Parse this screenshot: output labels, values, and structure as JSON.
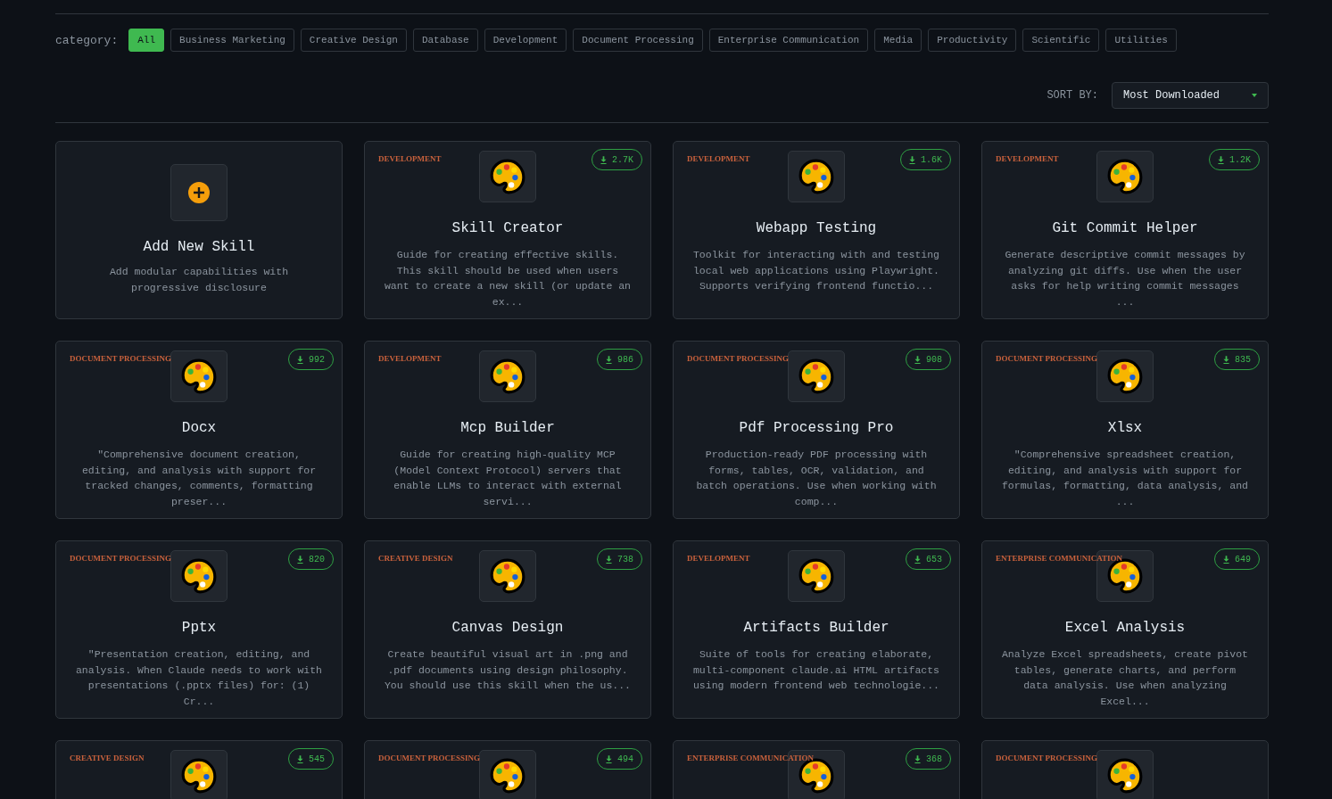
{
  "filter": {
    "label": "category:",
    "categories": [
      {
        "label": "All",
        "selected": true
      },
      {
        "label": "Business Marketing",
        "selected": false
      },
      {
        "label": "Creative Design",
        "selected": false
      },
      {
        "label": "Database",
        "selected": false
      },
      {
        "label": "Development",
        "selected": false
      },
      {
        "label": "Document Processing",
        "selected": false
      },
      {
        "label": "Enterprise Communication",
        "selected": false
      },
      {
        "label": "Media",
        "selected": false
      },
      {
        "label": "Productivity",
        "selected": false
      },
      {
        "label": "Scientific",
        "selected": false
      },
      {
        "label": "Utilities",
        "selected": false
      }
    ]
  },
  "sort": {
    "label": "SORT BY:",
    "value": "Most Downloaded"
  },
  "cards": [
    {
      "kind": "add",
      "title": "Add New Skill",
      "description": "Add modular capabilities with progressive disclosure"
    },
    {
      "kind": "skill",
      "category": "DEVELOPMENT",
      "downloads": "2.7K",
      "title": "Skill Creator",
      "description": "Guide for creating effective skills. This skill should be used when users want to create a new skill (or update an ex..."
    },
    {
      "kind": "skill",
      "category": "DEVELOPMENT",
      "downloads": "1.6K",
      "title": "Webapp Testing",
      "description": "Toolkit for interacting with and testing local web applications using Playwright. Supports verifying frontend functio..."
    },
    {
      "kind": "skill",
      "category": "DEVELOPMENT",
      "downloads": "1.2K",
      "title": "Git Commit Helper",
      "description": "Generate descriptive commit messages by analyzing git diffs. Use when the user asks for help writing commit messages ..."
    },
    {
      "kind": "skill",
      "category": "DOCUMENT PROCESSING",
      "downloads": "992",
      "title": "Docx",
      "description": "\"Comprehensive document creation, editing, and analysis with support for tracked changes, comments, formatting preser..."
    },
    {
      "kind": "skill",
      "category": "DEVELOPMENT",
      "downloads": "986",
      "title": "Mcp Builder",
      "description": "Guide for creating high-quality MCP (Model Context Protocol) servers that enable LLMs to interact with external servi..."
    },
    {
      "kind": "skill",
      "category": "DOCUMENT PROCESSING",
      "downloads": "908",
      "title": "Pdf Processing Pro",
      "description": "Production-ready PDF processing with forms, tables, OCR, validation, and batch operations. Use when working with comp..."
    },
    {
      "kind": "skill",
      "category": "DOCUMENT PROCESSING",
      "downloads": "835",
      "title": "Xlsx",
      "description": "\"Comprehensive spreadsheet creation, editing, and analysis with support for formulas, formatting, data analysis, and ..."
    },
    {
      "kind": "skill",
      "category": "DOCUMENT PROCESSING",
      "downloads": "820",
      "title": "Pptx",
      "description": "\"Presentation creation, editing, and analysis. When Claude needs to work with presentations (.pptx files) for: (1) Cr..."
    },
    {
      "kind": "skill",
      "category": "CREATIVE DESIGN",
      "downloads": "738",
      "title": "Canvas Design",
      "description": "Create beautiful visual art in .png and .pdf documents using design philosophy. You should use this skill when the us..."
    },
    {
      "kind": "skill",
      "category": "DEVELOPMENT",
      "downloads": "653",
      "title": "Artifacts Builder",
      "description": "Suite of tools for creating elaborate, multi-component claude.ai HTML artifacts using modern frontend web technologie..."
    },
    {
      "kind": "skill",
      "category": "ENTERPRISE COMMUNICATION",
      "downloads": "649",
      "title": "Excel Analysis",
      "description": "Analyze Excel spreadsheets, create pivot tables, generate charts, and perform data analysis. Use when analyzing Excel..."
    },
    {
      "kind": "skill",
      "category": "CREATIVE DESIGN",
      "downloads": "545"
    },
    {
      "kind": "skill",
      "category": "DOCUMENT PROCESSING",
      "downloads": "494"
    },
    {
      "kind": "skill",
      "category": "ENTERPRISE COMMUNICATION",
      "downloads": "368"
    },
    {
      "kind": "skill",
      "category": "DOCUMENT PROCESSING"
    }
  ]
}
